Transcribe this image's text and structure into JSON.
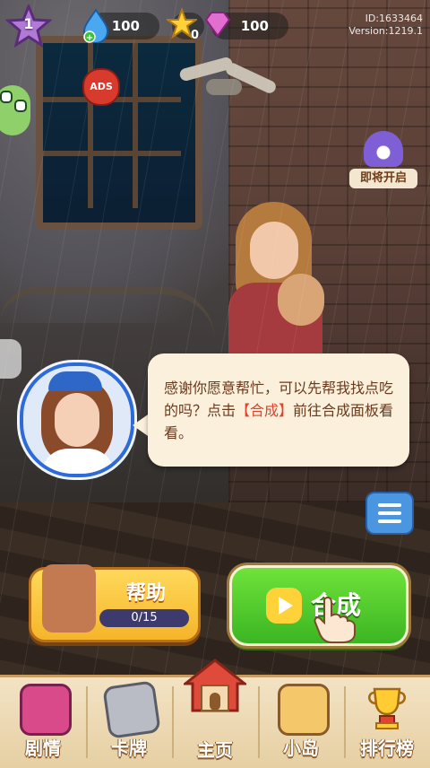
{
  "hud": {
    "level": "1",
    "energy": "100",
    "stars": "0",
    "gems": "100",
    "build_id": "ID:1633464",
    "version": "Version:1219.1"
  },
  "ads_label": "ADS",
  "coming_soon_label": "即将开启",
  "dialog": {
    "text_before": "感谢你愿意帮忙，可以先帮我找点吃的吗？点击",
    "highlight": "【合成】",
    "text_after": "前往合成面板看看。"
  },
  "help_button": {
    "label": "帮助",
    "progress_text": "0/15",
    "progress_fraction": 0
  },
  "merge_button": {
    "label": "合成"
  },
  "bottom_nav": [
    {
      "label": "剧情",
      "icon": "story-book-icon",
      "active": false
    },
    {
      "label": "卡牌",
      "icon": "cards-icon",
      "active": false
    },
    {
      "label": "主页",
      "icon": "home-icon",
      "active": true
    },
    {
      "label": "小岛",
      "icon": "island-compass-icon",
      "active": false
    },
    {
      "label": "排行榜",
      "icon": "trophy-icon",
      "active": false
    }
  ],
  "colors": {
    "accent_green": "#3bb523",
    "accent_yellow": "#f5b52a",
    "dialog_bg": "#faf0dc",
    "dialog_text": "#6b3a1c",
    "highlight_text": "#e0442d"
  }
}
